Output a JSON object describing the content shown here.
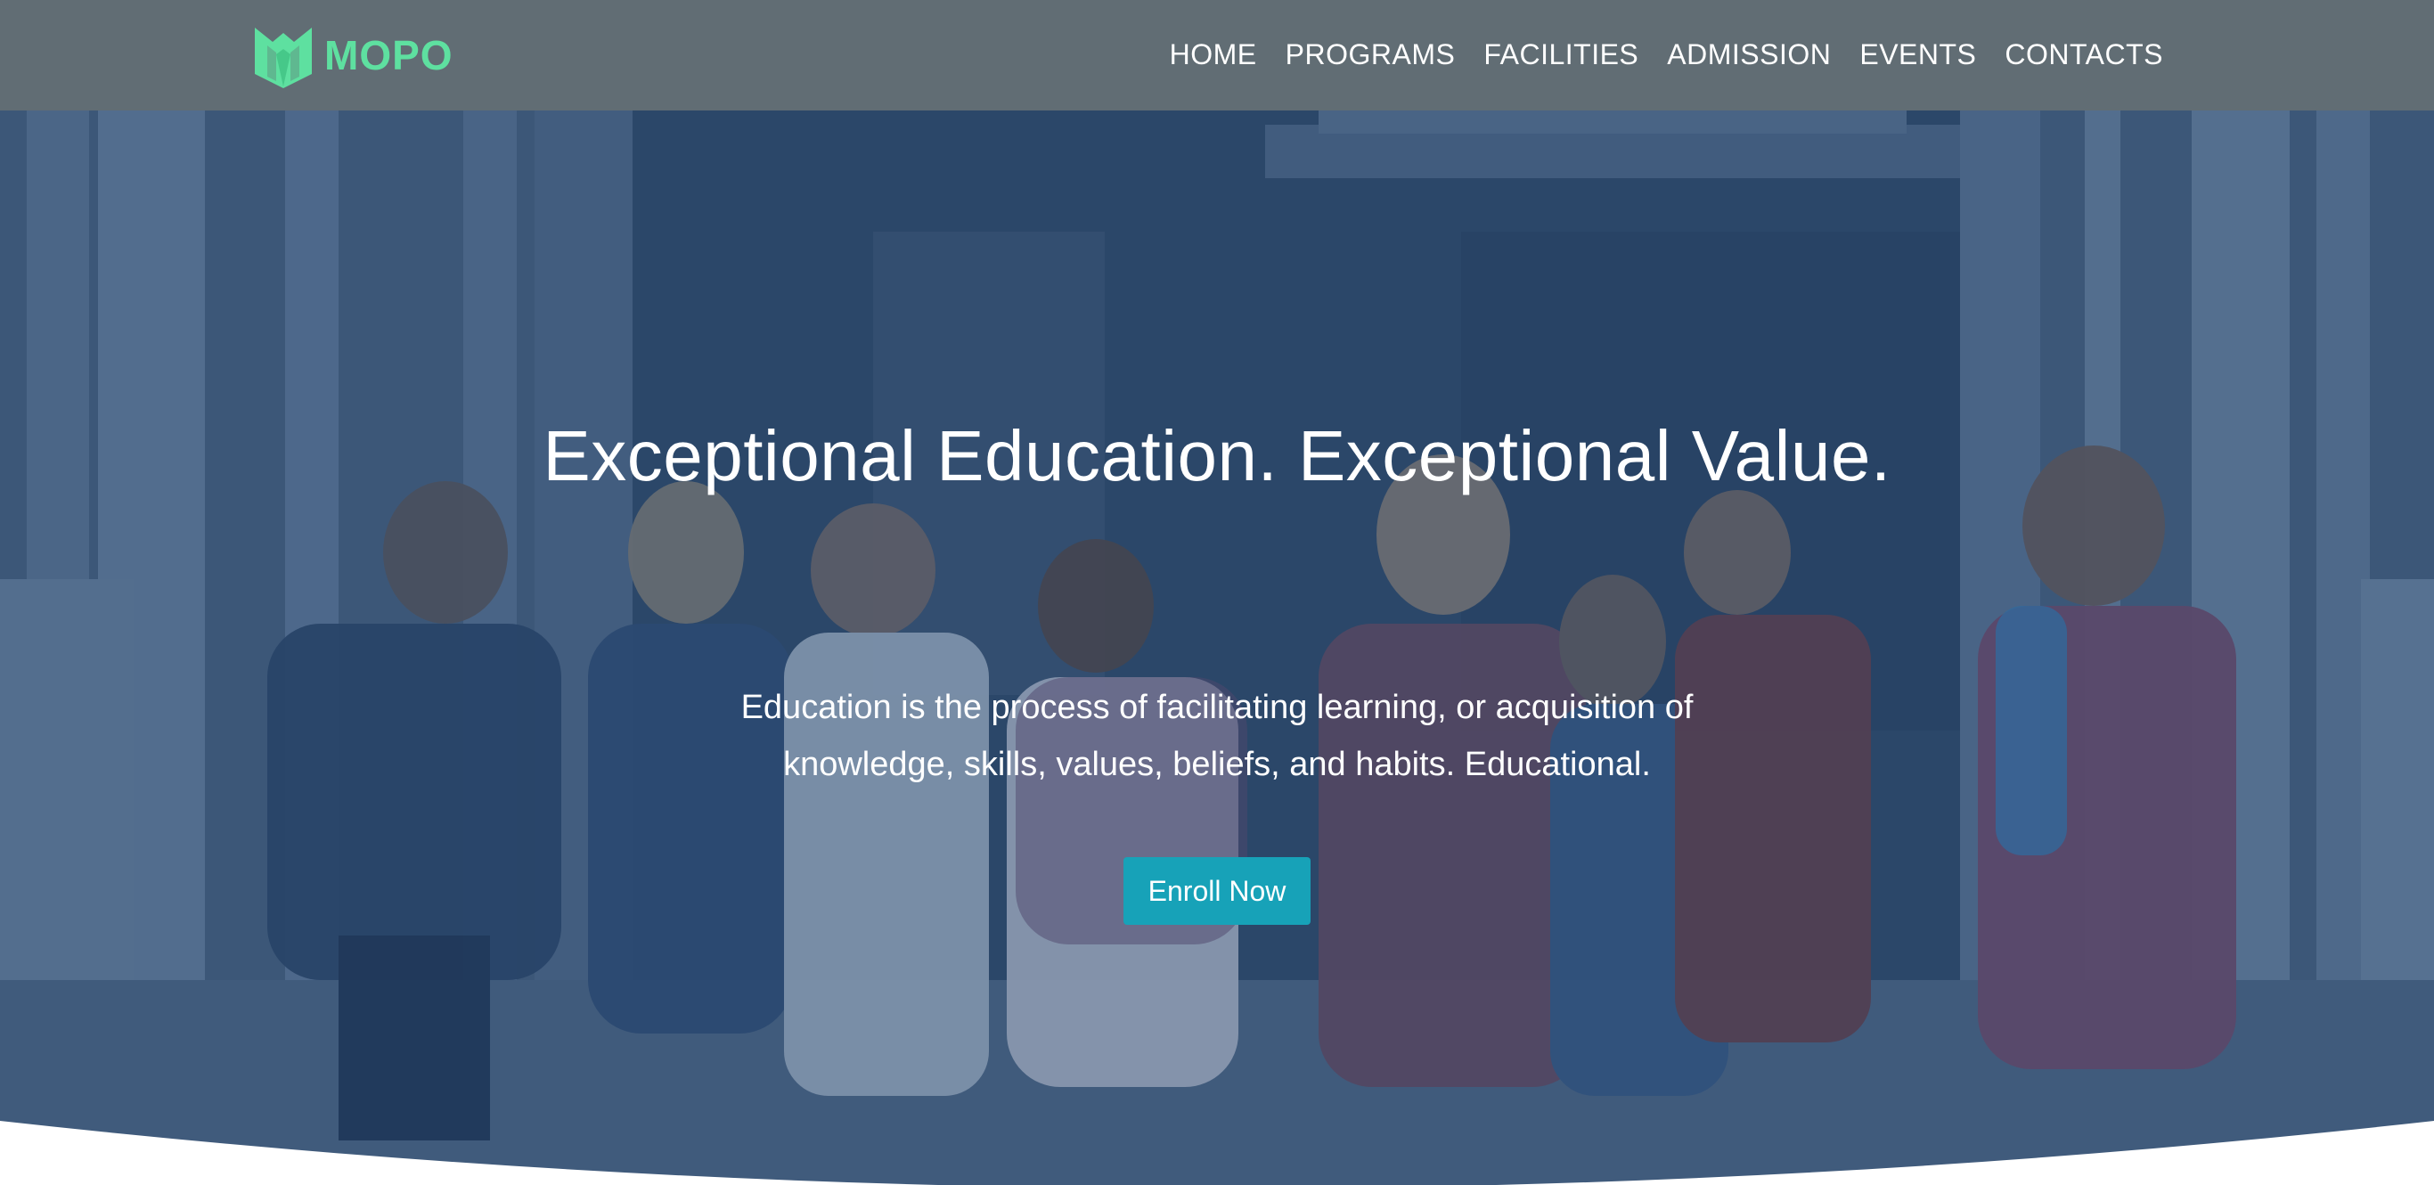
{
  "header": {
    "logo_text": "MOPO",
    "nav": [
      {
        "label": "HOME"
      },
      {
        "label": "PROGRAMS"
      },
      {
        "label": "FACILITIES"
      },
      {
        "label": "ADMISSION"
      },
      {
        "label": "EVENTS"
      },
      {
        "label": "CONTACTS"
      }
    ]
  },
  "hero": {
    "title": "Exceptional Education. Exceptional Value.",
    "subtitle": "Education is the process of facilitating learning, or acquisition of knowledge, skills, values, beliefs, and habits. Educational.",
    "cta_label": "Enroll Now",
    "background_image": "children-running-with-backpacks-photo"
  },
  "colors": {
    "header_bg": "#616d74",
    "logo": "#5ee0a0",
    "cta": "#17a2b8",
    "overlay": "#224470",
    "text": "#ffffff"
  },
  "icons": {
    "logo_mark": "m-shield-logo-icon"
  }
}
